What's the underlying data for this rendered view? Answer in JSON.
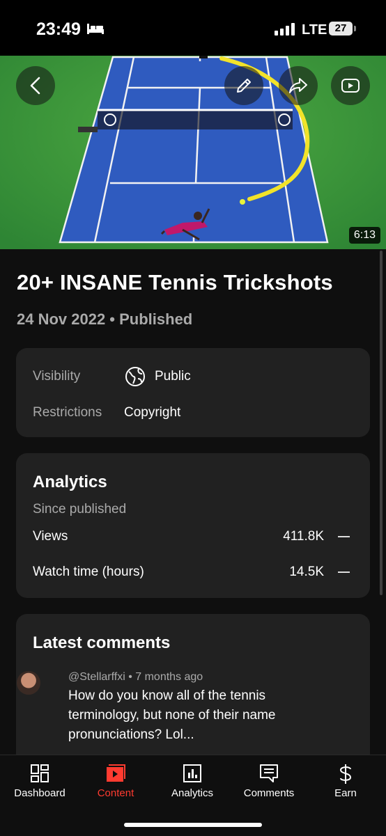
{
  "status_bar": {
    "time": "23:49",
    "network": "LTE",
    "battery": "27",
    "icons": [
      "bed-icon",
      "signal-bars-icon"
    ]
  },
  "video": {
    "duration": "6:13",
    "title": "20+ INSANE Tennis Trickshots",
    "subtitle": "24 Nov 2022 • Published",
    "buttons": [
      "back-icon",
      "edit-icon",
      "share-icon",
      "open-in-youtube-icon"
    ]
  },
  "visibility_card": {
    "visibility_label": "Visibility",
    "visibility_value": "Public",
    "restrictions_label": "Restrictions",
    "restrictions_value": "Copyright"
  },
  "analytics_card": {
    "heading": "Analytics",
    "since": "Since published",
    "rows": [
      {
        "label": "Views",
        "value": "411.8K"
      },
      {
        "label": "Watch time (hours)",
        "value": "14.5K"
      }
    ]
  },
  "comments_card": {
    "heading": "Latest comments",
    "comment": {
      "meta": "@Stellarffxi • 7 months ago",
      "text": "How do you know all of the tennis terminology, but none of their name pronunciations? Lol..."
    }
  },
  "bottom_nav": [
    {
      "label": "Dashboard",
      "icon": "dashboard-icon"
    },
    {
      "label": "Content",
      "icon": "content-icon",
      "active": true
    },
    {
      "label": "Analytics",
      "icon": "analytics-icon"
    },
    {
      "label": "Comments",
      "icon": "comments-icon"
    },
    {
      "label": "Earn",
      "icon": "dollar-icon"
    }
  ],
  "colors": {
    "background": "#0f0f0f",
    "card": "#212121",
    "active_nav": "#ff3b30",
    "court_blue": "#2f5bbf",
    "grass_green": "#3d9a3a"
  }
}
